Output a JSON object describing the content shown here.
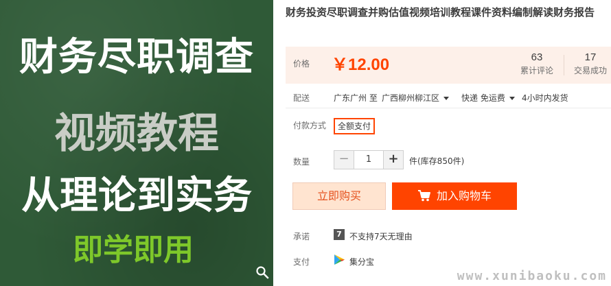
{
  "image": {
    "lines": [
      "财务尽职调查",
      "视频教程",
      "从理论到实务",
      "即学即用"
    ],
    "zoom_icon": "search-icon",
    "colors": {
      "board": "#2f5a37",
      "line1": "#ffffff",
      "line2": "#c9cdc6",
      "line4": "#7ec82a"
    }
  },
  "product": {
    "title": "财务投资尽职调查并购估值视频培训教程课件资料编制解读财务报告"
  },
  "price": {
    "label": "价格",
    "value": "￥12.00",
    "reviews_count": "63",
    "reviews_label": "累计评论",
    "sales_count": "17",
    "sales_label": "交易成功"
  },
  "shipping": {
    "label": "配送",
    "from": "广东广州 至",
    "to": "广西柳州柳江区",
    "method": "快递 免运费",
    "dispatch": "4小时内发货"
  },
  "payment": {
    "label": "付款方式",
    "option": "全额支付"
  },
  "quantity": {
    "label": "数量",
    "minus": "−",
    "value": "1",
    "plus": "+",
    "stock": "件(库存850件)"
  },
  "actions": {
    "buy_now": "立即购买",
    "add_to_cart": "加入购物车",
    "cart_icon": "cart-icon"
  },
  "promise": {
    "label": "承诺",
    "icon_text": "7",
    "text": "不支持7天无理由"
  },
  "pay_method": {
    "label": "支付",
    "icon": "jifenbao-icon",
    "text": "集分宝"
  },
  "watermark": "www.xunibaoku.com",
  "colors": {
    "accent": "#ff4400",
    "price_bg": "#fdf0e9",
    "buy_now_bg": "#ffe4d0"
  }
}
